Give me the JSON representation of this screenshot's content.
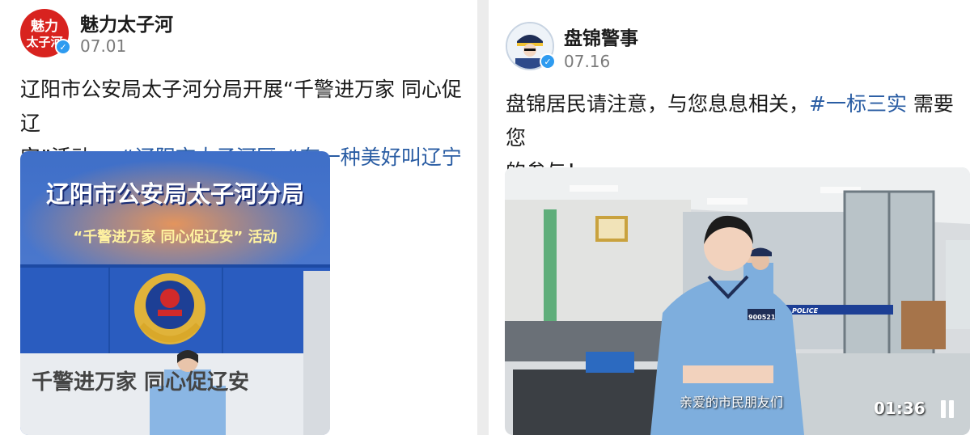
{
  "left_post": {
    "avatar_text": "魅力太子河",
    "account_name": "魅力太子河",
    "date": "07.01",
    "text_line1": "辽阳市公安局太子河分局开展“千警进万家 同心促辽",
    "text_line2_plain": "安”活动。",
    "hashtags": [
      "#辽阳市太子河区",
      "#有一种美好叫辽宁"
    ],
    "image": {
      "headline": "辽阳市公安局太子河分局",
      "subline": "“千警进万家 同心促辽安” 活动",
      "wall_slogan": "千警进万家 同心促辽安"
    }
  },
  "right_post": {
    "account_name": "盘锦警事",
    "date": "07.16",
    "text_line1_plain": "盘锦居民请注意，与您息息相关，",
    "hashtag": "#一标三实",
    "text_line1_tail": "需要您",
    "text_line2": "的参与！",
    "video": {
      "subtitle": "亲爱的市民朋友们",
      "duration": "01:36",
      "badge_number": "900521",
      "police_strip": "POLICE"
    }
  },
  "colors": {
    "hashtag": "#295ca3",
    "verified": "#2e9bf0",
    "avatar_red": "#d8231f",
    "police_shirt": "#7eaedd"
  },
  "icons": [
    "verified-icon",
    "pause-icon",
    "police-emblem-icon"
  ]
}
